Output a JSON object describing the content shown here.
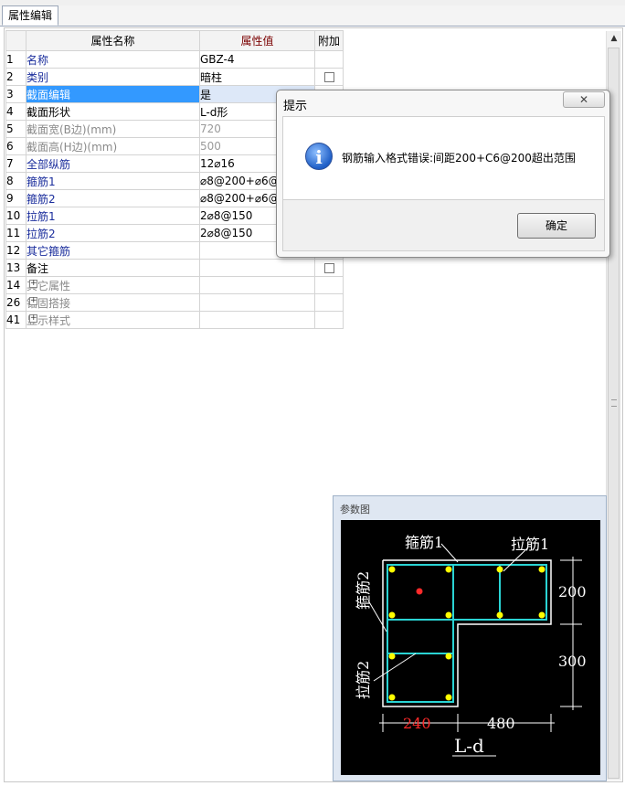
{
  "tab": {
    "label": "属性编辑"
  },
  "grid": {
    "headers": {
      "name": "属性名称",
      "value": "属性值",
      "extra": "附加"
    },
    "rows": [
      {
        "num": "1",
        "name": "名称",
        "value": "GBZ-4"
      },
      {
        "num": "2",
        "name": "类别",
        "value": "暗柱"
      },
      {
        "num": "3",
        "name": "截面编辑",
        "value": "是"
      },
      {
        "num": "4",
        "name": "截面形状",
        "value": "L-d形"
      },
      {
        "num": "5",
        "name": "截面宽(B边)(mm)",
        "value": "720"
      },
      {
        "num": "6",
        "name": "截面高(H边)(mm)",
        "value": "500"
      },
      {
        "num": "7",
        "name": "全部纵筋",
        "value": "12⌀16"
      },
      {
        "num": "8",
        "name": "箍筋1",
        "value": "⌀8@200+⌀6@2"
      },
      {
        "num": "9",
        "name": "箍筋2",
        "value": "⌀8@200+⌀6@2"
      },
      {
        "num": "10",
        "name": "拉筋1",
        "value": "2⌀8@150"
      },
      {
        "num": "11",
        "name": "拉筋2",
        "value": "2⌀8@150"
      },
      {
        "num": "12",
        "name": "其它箍筋",
        "value": ""
      },
      {
        "num": "13",
        "name": "备注",
        "value": ""
      },
      {
        "num": "14",
        "name": "其它属性",
        "value": ""
      },
      {
        "num": "26",
        "name": "锚固搭接",
        "value": ""
      },
      {
        "num": "41",
        "name": "显示样式",
        "value": ""
      }
    ]
  },
  "dialog": {
    "title": "提示",
    "close_label": "✕",
    "message": "钢筋输入格式错误:间距200+C6@200超出范围",
    "ok_label": "确定",
    "icon_glyph": "i"
  },
  "param_window": {
    "title": "参数图",
    "labels": {
      "stirrup1": "箍筋1",
      "tie1": "拉筋1",
      "stirrup2": "箍筋2",
      "tie2": "拉筋2",
      "dim_200": "200",
      "dim_300": "300",
      "dim_240": "240",
      "dim_480": "480",
      "shape": "L-d"
    }
  },
  "colors": {
    "selection": "#3399ff",
    "header_value_bg": "#f0b862",
    "link_text": "#1a2d9c",
    "diagram_outline": "#ffffff",
    "stirrup": "#2ad4d4",
    "rebar_dot": "#ffff00",
    "highlight_dim": "#ff2a2a"
  }
}
